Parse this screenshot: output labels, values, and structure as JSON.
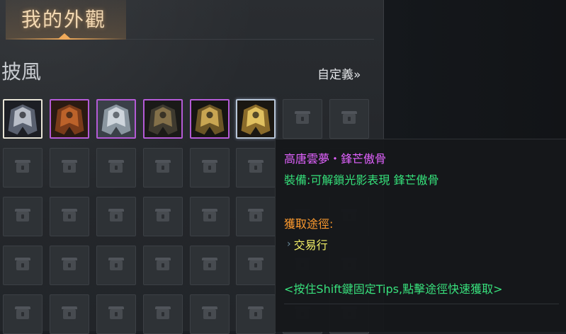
{
  "header": {
    "title": "我的外觀"
  },
  "section": {
    "title": "披風",
    "customize_label": "自定義»"
  },
  "items": [
    {
      "name": "cape-item-1-icon",
      "rarity": "first"
    },
    {
      "name": "cape-item-2-icon",
      "rarity": "epic"
    },
    {
      "name": "cape-item-3-icon",
      "rarity": "epic"
    },
    {
      "name": "cape-item-4-icon",
      "rarity": "epic"
    },
    {
      "name": "cape-item-5-icon",
      "rarity": "epic"
    },
    {
      "name": "cape-item-6-icon",
      "rarity": "legend"
    }
  ],
  "tooltip": {
    "item_name": "高唐雲夢・鋒芒傲骨",
    "equip_effect": "裝備:可解鎖光影表現 鋒芒傲骨",
    "source_title": "獲取途徑:",
    "source_item": "交易行",
    "hint": "<按住Shift鍵固定Tips,點擊途徑快速獲取>"
  },
  "colors": {
    "title": "#f3d9b3",
    "item_name": "#e262ff",
    "equip": "#35e07a",
    "source_title": "#ff9b2e",
    "source_item": "#f2ee66",
    "epic_border": "#b45ad6"
  }
}
